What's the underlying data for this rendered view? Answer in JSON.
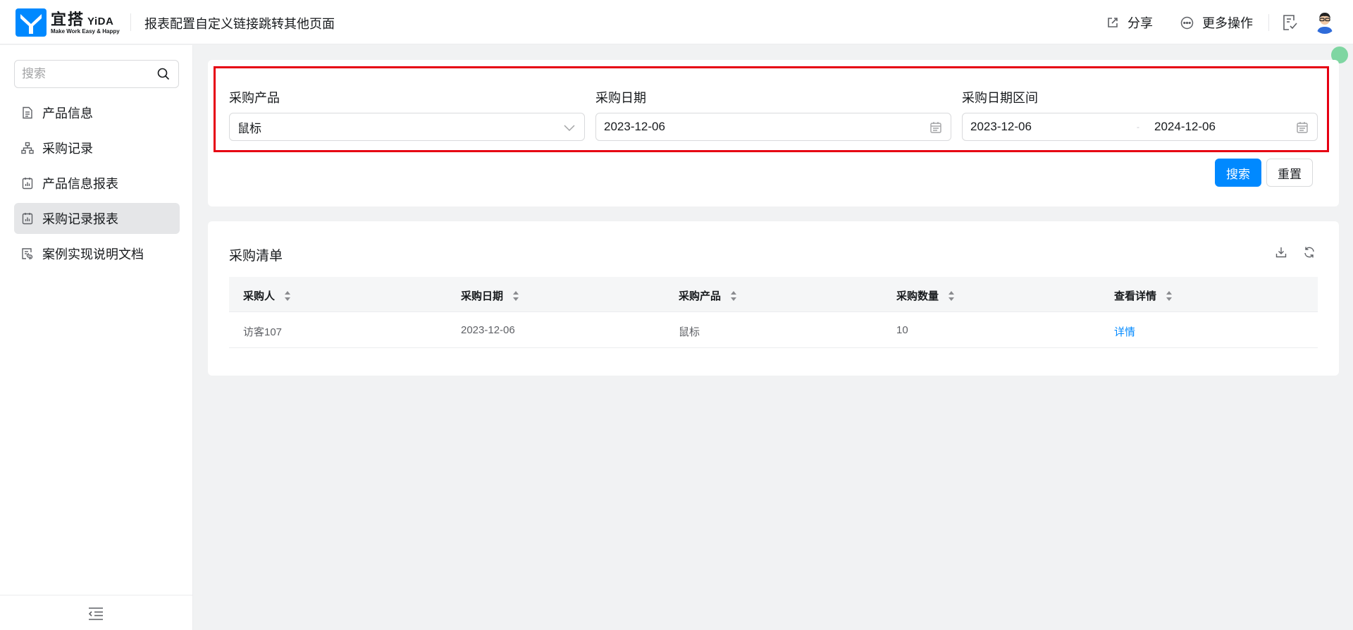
{
  "header": {
    "brand_cn": "宜搭",
    "brand_en": "YiDA",
    "slogan": "Make Work Easy & Happy",
    "page_title": "报表配置自定义链接跳转其他页面",
    "share_label": "分享",
    "more_label": "更多操作"
  },
  "sidebar": {
    "search_placeholder": "搜索",
    "items": [
      {
        "label": "产品信息",
        "icon": "document-icon"
      },
      {
        "label": "采购记录",
        "icon": "org-chart-icon"
      },
      {
        "label": "产品信息报表",
        "icon": "report-icon"
      },
      {
        "label": "采购记录报表",
        "icon": "report-icon",
        "active": true
      },
      {
        "label": "案例实现说明文档",
        "icon": "doc-link-icon"
      }
    ]
  },
  "filter": {
    "product_label": "采购产品",
    "product_value": "鼠标",
    "date_label": "采购日期",
    "date_value": "2023-12-06",
    "range_label": "采购日期区间",
    "range_start": "2023-12-06",
    "range_end": "2024-12-06",
    "range_sep": "-",
    "search_btn": "搜索",
    "reset_btn": "重置"
  },
  "table": {
    "title": "采购清单",
    "columns": [
      "采购人",
      "采购日期",
      "采购产品",
      "采购数量",
      "查看详情"
    ],
    "rows": [
      {
        "buyer": "访客107",
        "date": "2023-12-06",
        "product": "鼠标",
        "qty": "10",
        "detail": "详情"
      }
    ]
  },
  "colors": {
    "primary": "#0089ff",
    "highlight": "#e60012",
    "active_nav_bg": "#e5e6e8"
  }
}
